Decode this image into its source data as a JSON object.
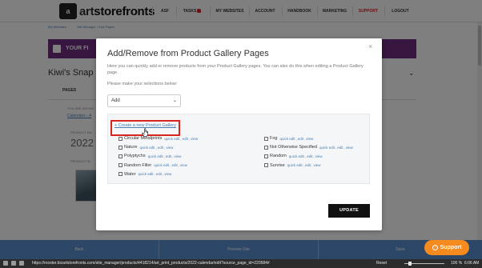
{
  "nav": {
    "brand_prefix": "art",
    "brand_suffix": "storefronts",
    "items": [
      "ASF",
      "TASKS",
      "MY WEBSITES",
      "ACCOUNT",
      "HANDBOOK",
      "MARKETING",
      "SUPPORT",
      "LOGOUT"
    ],
    "support_color": "#d4242c"
  },
  "background": {
    "breadcrumbs": [
      "My Websites",
      "Site Manager / Kiwi Pages"
    ],
    "promo_text": "YOUR FI",
    "page_title": "Kiwi's Snap",
    "tab_pages": "PAGES",
    "note": "YOU ARE WITHIN",
    "link": "Calendars › A",
    "product_label_1": "PRODUCT NA",
    "year": "2022 C",
    "product_label_2": "PRODUCT IN"
  },
  "modal": {
    "title": "Add/Remove from Product Gallery Pages",
    "description": "Here you can quickly add or remove products from your Product Gallery pages. You can also do this when editing a Product Gallery page.",
    "instruction": "Please make your selections below:",
    "action_select": {
      "value": "Add"
    },
    "create_link": "+ Create a new Product Gallery",
    "link_labels": {
      "quick_edit": "quick edit",
      "edit": "edit",
      "view": "view"
    },
    "galleries_left": [
      "Circular Metalprints",
      "Nature",
      "Polyptychs",
      "Random Filler",
      "Water"
    ],
    "galleries_right": [
      "Fog",
      "Not Otherwise Specified",
      "Random",
      "Sunrise"
    ],
    "update_label": "UPDATE"
  },
  "footer": {
    "back": "Back",
    "preview": "Preview Site",
    "save": "Save"
  },
  "support_label": "Support",
  "statusbar": {
    "url": "https://rooster.bizartstorefronts.com/site_manager/products/4418214/art_print_products/2022-calendar/edit?source_page_id=220584#",
    "reset": "Reset",
    "zoom": "100 %",
    "time": "6:06 AM"
  },
  "colors": {
    "accent_purple": "#6f2c7e",
    "footer_blue": "#5a8fd0",
    "highlight_red": "#d9231d",
    "support_orange": "#f58a1e"
  }
}
